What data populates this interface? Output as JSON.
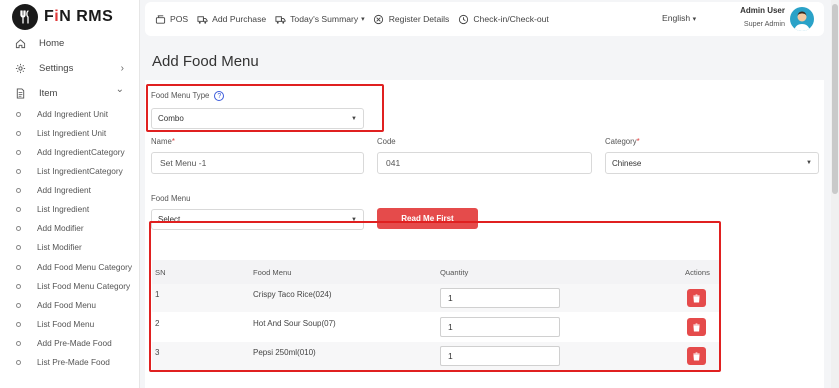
{
  "app": {
    "logo_text_a": "F",
    "logo_text_i": "i",
    "logo_text_b": "N RMS"
  },
  "sidebar": {
    "top_items": [
      {
        "label": "Home",
        "icon": "home-icon"
      },
      {
        "label": "Settings",
        "icon": "gear-icon",
        "chevron": "›"
      },
      {
        "label": "Item",
        "icon": "document-icon",
        "chevron": "⌄"
      }
    ],
    "sub_items": [
      "Add Ingredient Unit",
      "List Ingredient Unit",
      "Add IngredientCategory",
      "List IngredientCategory",
      "Add Ingredient",
      "List Ingredient",
      "Add Modifier",
      "List Modifier",
      "Add Food Menu Category",
      "List Food Menu Category",
      "Add Food Menu",
      "List Food Menu",
      "Add Pre-Made Food",
      "List Pre-Made Food"
    ]
  },
  "topbar": {
    "links": [
      {
        "label": "POS",
        "icon": "pos-icon"
      },
      {
        "label": "Add Purchase",
        "icon": "truck-icon"
      },
      {
        "label": "Today's Summary",
        "icon": "truck-icon",
        "caret": "▾"
      },
      {
        "label": "Register Details",
        "icon": "close-circle-icon"
      },
      {
        "label": "Check-in/Check-out",
        "icon": "clock-icon"
      }
    ],
    "language": "English",
    "language_caret": "▾",
    "user_name": "Admin User",
    "user_role": "Super Admin"
  },
  "page": {
    "title": "Add Food Menu"
  },
  "form": {
    "food_menu_type_label": "Food Menu Type",
    "help_glyph": "?",
    "food_menu_type_value": "Combo",
    "name_label": "Name",
    "name_value": "Set Menu -1",
    "code_label": "Code",
    "code_value": "041",
    "category_label": "Category",
    "category_value": "Chinese",
    "required_mark": "*",
    "food_menu_label": "Food Menu",
    "food_menu_placeholder": "Select",
    "read_me_button": "Read Me First"
  },
  "table": {
    "headers": {
      "sn": "SN",
      "food_menu": "Food Menu",
      "quantity": "Quantity",
      "actions": "Actions"
    },
    "rows": [
      {
        "sn": "1",
        "food_menu": "Crispy Taco Rice(024)",
        "quantity": "1"
      },
      {
        "sn": "2",
        "food_menu": "Hot And Sour Soup(07)",
        "quantity": "1"
      },
      {
        "sn": "3",
        "food_menu": "Pepsi 250ml(010)",
        "quantity": "1"
      }
    ]
  },
  "colors": {
    "accent_red": "#e54b4b",
    "highlight_red": "#e02020",
    "help_blue": "#3b5bdb"
  }
}
